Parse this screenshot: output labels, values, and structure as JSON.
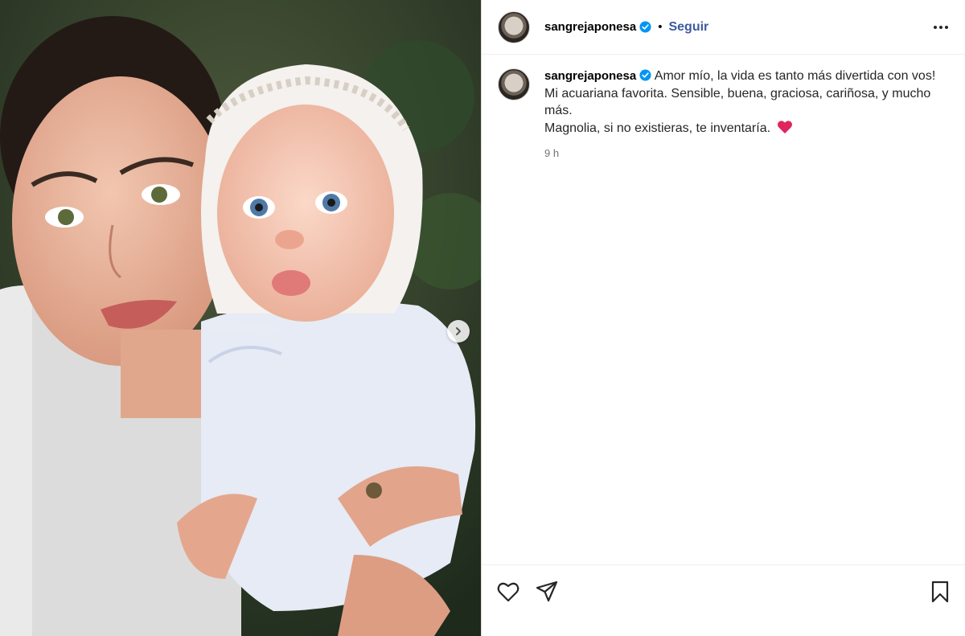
{
  "post": {
    "username": "sangrejaponesa",
    "separator": "•",
    "follow_label": "Seguir",
    "caption_lines": [
      "Amor mío, la vida es tanto más divertida con vos!",
      "Mi acuariana favorita. Sensible, buena, graciosa, cariñosa, y mucho más.",
      "Magnolia, si no existieras, te inventaría."
    ],
    "caption_emoji": "heart-emoji",
    "time_ago": "9 h"
  },
  "colors": {
    "follow": "#3d5aa0",
    "verified": "#0095f6",
    "heart": "#e0245e",
    "border": "#dbdbdb"
  },
  "icons": [
    "verified-icon",
    "more-options-icon",
    "chevron-right-icon",
    "like-icon",
    "share-icon",
    "save-icon"
  ]
}
